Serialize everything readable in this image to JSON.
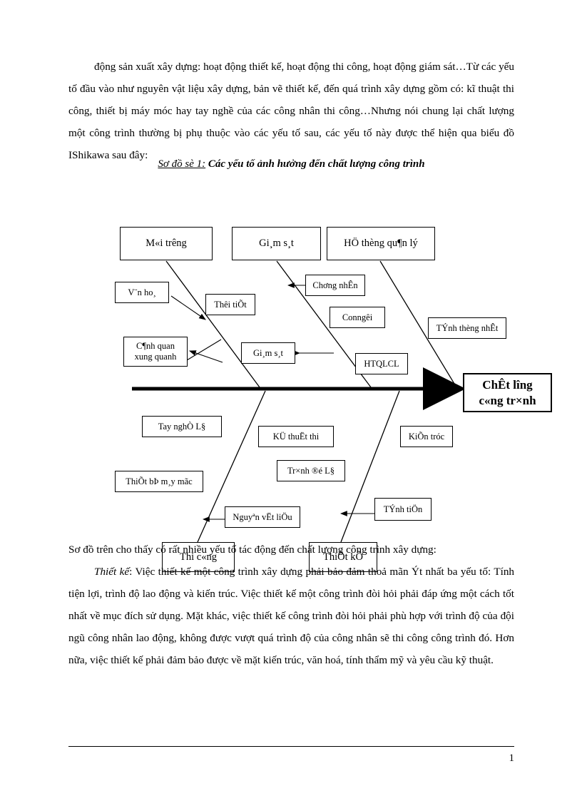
{
  "document": {
    "intro_paragraph": "động sản xuất xây dựng: hoạt động thiết kế, hoạt động thi công, hoạt động giám sát…Từ các yếu tố đầu vào như nguyên vật liệu xây dựng, bản vẽ thiết kế, đến quá trình xây dựng gồm có: kĩ thuật thi công, thiết bị máy móc hay tay nghề của các công nhân thi công…Nhưng nói chung lại chất lượng một công trình thường bị phụ thuộc vào các yếu tố sau, các yếu tố này được thể hiện qua biểu đồ IShikawa sau đây:",
    "diagram_caption_label": "Sơ đồ sè 1:",
    "diagram_caption_text": "Các yếu tố ảnh hưởng đến chất lượng công trình",
    "outro_line_1": "Sơ đồ trên cho thấy có rất nhiều yếu tố tác động đến chất lượng công trình xây dựng:",
    "outro_paragraph_label": "Thiết kế",
    "outro_paragraph": ": Việc thiết kế một công trình xây dựng phải bảo đảm thoả mãn Ýt nhất ba yếu tố: Tính tiện lợi, trình độ lao động và kiến trúc. Việc thiết kế một công trình đòi hỏi phải đáp ứng một cách tốt nhất về mục đích sử dụng. Mặt khác, việc thiết kế công trình đòi hỏi phải phù hợp với trình độ của đội ngũ công nhân lao động, không được vượt quá trình độ của công nhân sẽ thi công công trình đó. Hơn nữa, việc thiết kế phải đảm bảo được về mặt kiến trúc, văn hoá, tính thẩm mỹ và yêu cầu kỹ thuật.",
    "page_number": "1"
  },
  "diagram": {
    "head_label": "ChÊt lîng\nc«ng tr×nh",
    "top_categories": [
      {
        "id": "moi-truong",
        "label": "M«i trêng"
      },
      {
        "id": "giam-sat",
        "label": "Gi¸m s¸t"
      },
      {
        "id": "he-thong-quan-ly",
        "label": "HÖ thèng qu¶n lý"
      }
    ],
    "bottom_categories": [
      {
        "id": "thi-cong",
        "label": "Thi c«ng"
      },
      {
        "id": "thiet-ke",
        "label": "ThiÕt kÕ"
      }
    ],
    "causes": [
      {
        "id": "van-hoa",
        "label": "V¨n ho¸"
      },
      {
        "id": "thoi-tiet",
        "label": "Thêi tiÕt"
      },
      {
        "id": "chung-nhan",
        "label": "Chơng nhÊn"
      },
      {
        "id": "cong-nghe",
        "label": "Conngêi"
      },
      {
        "id": "tinh-thuong-nhat",
        "label": "TÝnh thèng nhÊt"
      },
      {
        "id": "canh-quan",
        "label": "C¶nh quan\nxung quanh"
      },
      {
        "id": "giam-sat-2",
        "label": "Gi¸m s¸t"
      },
      {
        "id": "htqlcl",
        "label": "HTQLCL"
      },
      {
        "id": "tay-nghe",
        "label": "Tay nghÒ L§"
      },
      {
        "id": "ky-thuat-thi",
        "label": "KÜ thuËt thi"
      },
      {
        "id": "kien-truc",
        "label": "KiÕn tróc"
      },
      {
        "id": "thiet-bi-may-moc",
        "label": "ThiÕt bÞ m¸y mãc"
      },
      {
        "id": "trinh-do-ld",
        "label": "Tr×nh ®é L§"
      },
      {
        "id": "nguyen-vat-lieu",
        "label": "Nguyªn vËt liÖu"
      },
      {
        "id": "tinh-tien",
        "label": "TÝnh tiÖn"
      }
    ]
  }
}
